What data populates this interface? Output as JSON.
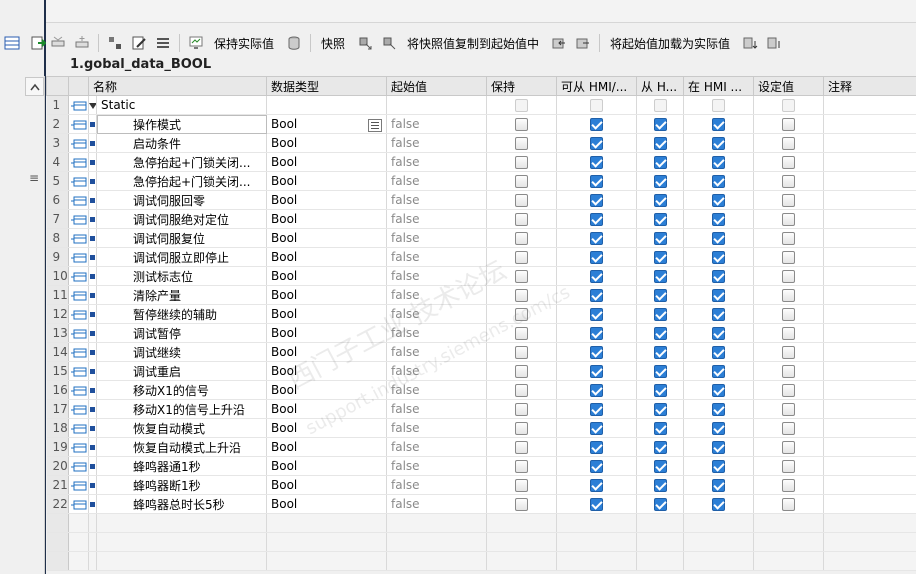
{
  "block_title": "1.gobal_data_BOOL",
  "toolbar": {
    "keep_actual_label": "保持实际值",
    "snapshot_label": "快照",
    "copy_snapshot_label": "将快照值复制到起始值中",
    "load_start_label": "将起始值加载为实际值"
  },
  "columns": [
    "名称",
    "数据类型",
    "起始值",
    "保持",
    "可从 HMI/...",
    "从 H...",
    "在 HMI ...",
    "设定值",
    "注释"
  ],
  "static_row": {
    "num": "1",
    "name": "Static"
  },
  "rows": [
    {
      "num": "2",
      "name": "操作模式",
      "type": "Bool",
      "start": "false"
    },
    {
      "num": "3",
      "name": "启动条件",
      "type": "Bool",
      "start": "false"
    },
    {
      "num": "4",
      "name": "急停抬起+门锁关闭...",
      "type": "Bool",
      "start": "false"
    },
    {
      "num": "5",
      "name": "急停抬起+门锁关闭...",
      "type": "Bool",
      "start": "false"
    },
    {
      "num": "6",
      "name": "调试伺服回零",
      "type": "Bool",
      "start": "false"
    },
    {
      "num": "7",
      "name": "调试伺服绝对定位",
      "type": "Bool",
      "start": "false"
    },
    {
      "num": "8",
      "name": "调试伺服复位",
      "type": "Bool",
      "start": "false"
    },
    {
      "num": "9",
      "name": "调试伺服立即停止",
      "type": "Bool",
      "start": "false"
    },
    {
      "num": "10",
      "name": "测试标志位",
      "type": "Bool",
      "start": "false"
    },
    {
      "num": "11",
      "name": "清除产量",
      "type": "Bool",
      "start": "false"
    },
    {
      "num": "12",
      "name": "暂停继续的辅助",
      "type": "Bool",
      "start": "false"
    },
    {
      "num": "13",
      "name": "调试暂停",
      "type": "Bool",
      "start": "false"
    },
    {
      "num": "14",
      "name": "调试继续",
      "type": "Bool",
      "start": "false"
    },
    {
      "num": "15",
      "name": "调试重启",
      "type": "Bool",
      "start": "false"
    },
    {
      "num": "16",
      "name": "移动X1的信号",
      "type": "Bool",
      "start": "false"
    },
    {
      "num": "17",
      "name": "移动X1的信号上升沿",
      "type": "Bool",
      "start": "false"
    },
    {
      "num": "18",
      "name": "恢复自动模式",
      "type": "Bool",
      "start": "false"
    },
    {
      "num": "19",
      "name": "恢复自动模式上升沿",
      "type": "Bool",
      "start": "false"
    },
    {
      "num": "20",
      "name": "蜂鸣器通1秒",
      "type": "Bool",
      "start": "false"
    },
    {
      "num": "21",
      "name": "蜂鸣器断1秒",
      "type": "Bool",
      "start": "false"
    },
    {
      "num": "22",
      "name": "蜂鸣器总时长5秒",
      "type": "Bool",
      "start": "false"
    }
  ],
  "watermark": {
    "line1": "西门子工业 技术论坛",
    "line2": "support.industry.siemens.com/cs"
  }
}
